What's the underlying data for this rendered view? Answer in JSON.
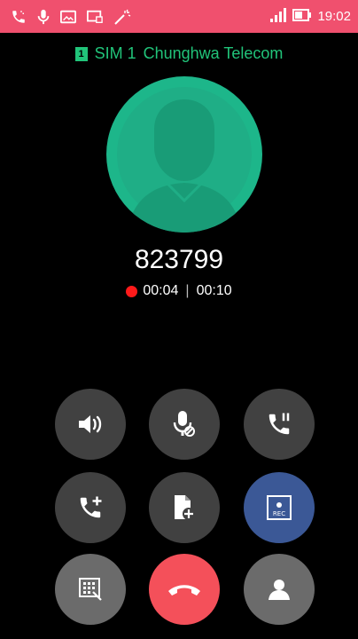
{
  "status_bar": {
    "time": "19:02",
    "colors": {
      "background": "#f0506e"
    },
    "icons": [
      "call-icon",
      "microphone-icon",
      "message-icon",
      "cast-icon",
      "cleaner-icon",
      "signal-icon",
      "battery-icon"
    ]
  },
  "sim": {
    "badge": "1",
    "label": "SIM 1",
    "carrier": "Chunghwa Telecom",
    "color": "#21c47a"
  },
  "call": {
    "number": "823799",
    "elapsed": "00:04",
    "total": "00:10",
    "recording_color": "#ff1a1a"
  },
  "controls": [
    {
      "name": "speaker",
      "icon": "speaker-icon"
    },
    {
      "name": "mute",
      "icon": "mute-microphone-icon"
    },
    {
      "name": "hold",
      "icon": "hold-call-icon"
    },
    {
      "name": "add-call",
      "icon": "add-call-icon"
    },
    {
      "name": "add-note",
      "icon": "add-note-icon"
    },
    {
      "name": "record",
      "icon": "record-icon",
      "label": "REC",
      "color": "#3b5896"
    },
    {
      "name": "keypad",
      "icon": "keypad-icon"
    },
    {
      "name": "end-call",
      "icon": "end-call-icon",
      "color": "#f4505a"
    },
    {
      "name": "contacts",
      "icon": "contact-icon"
    }
  ],
  "colors": {
    "avatar": "#1db68a",
    "button": "#414141"
  }
}
